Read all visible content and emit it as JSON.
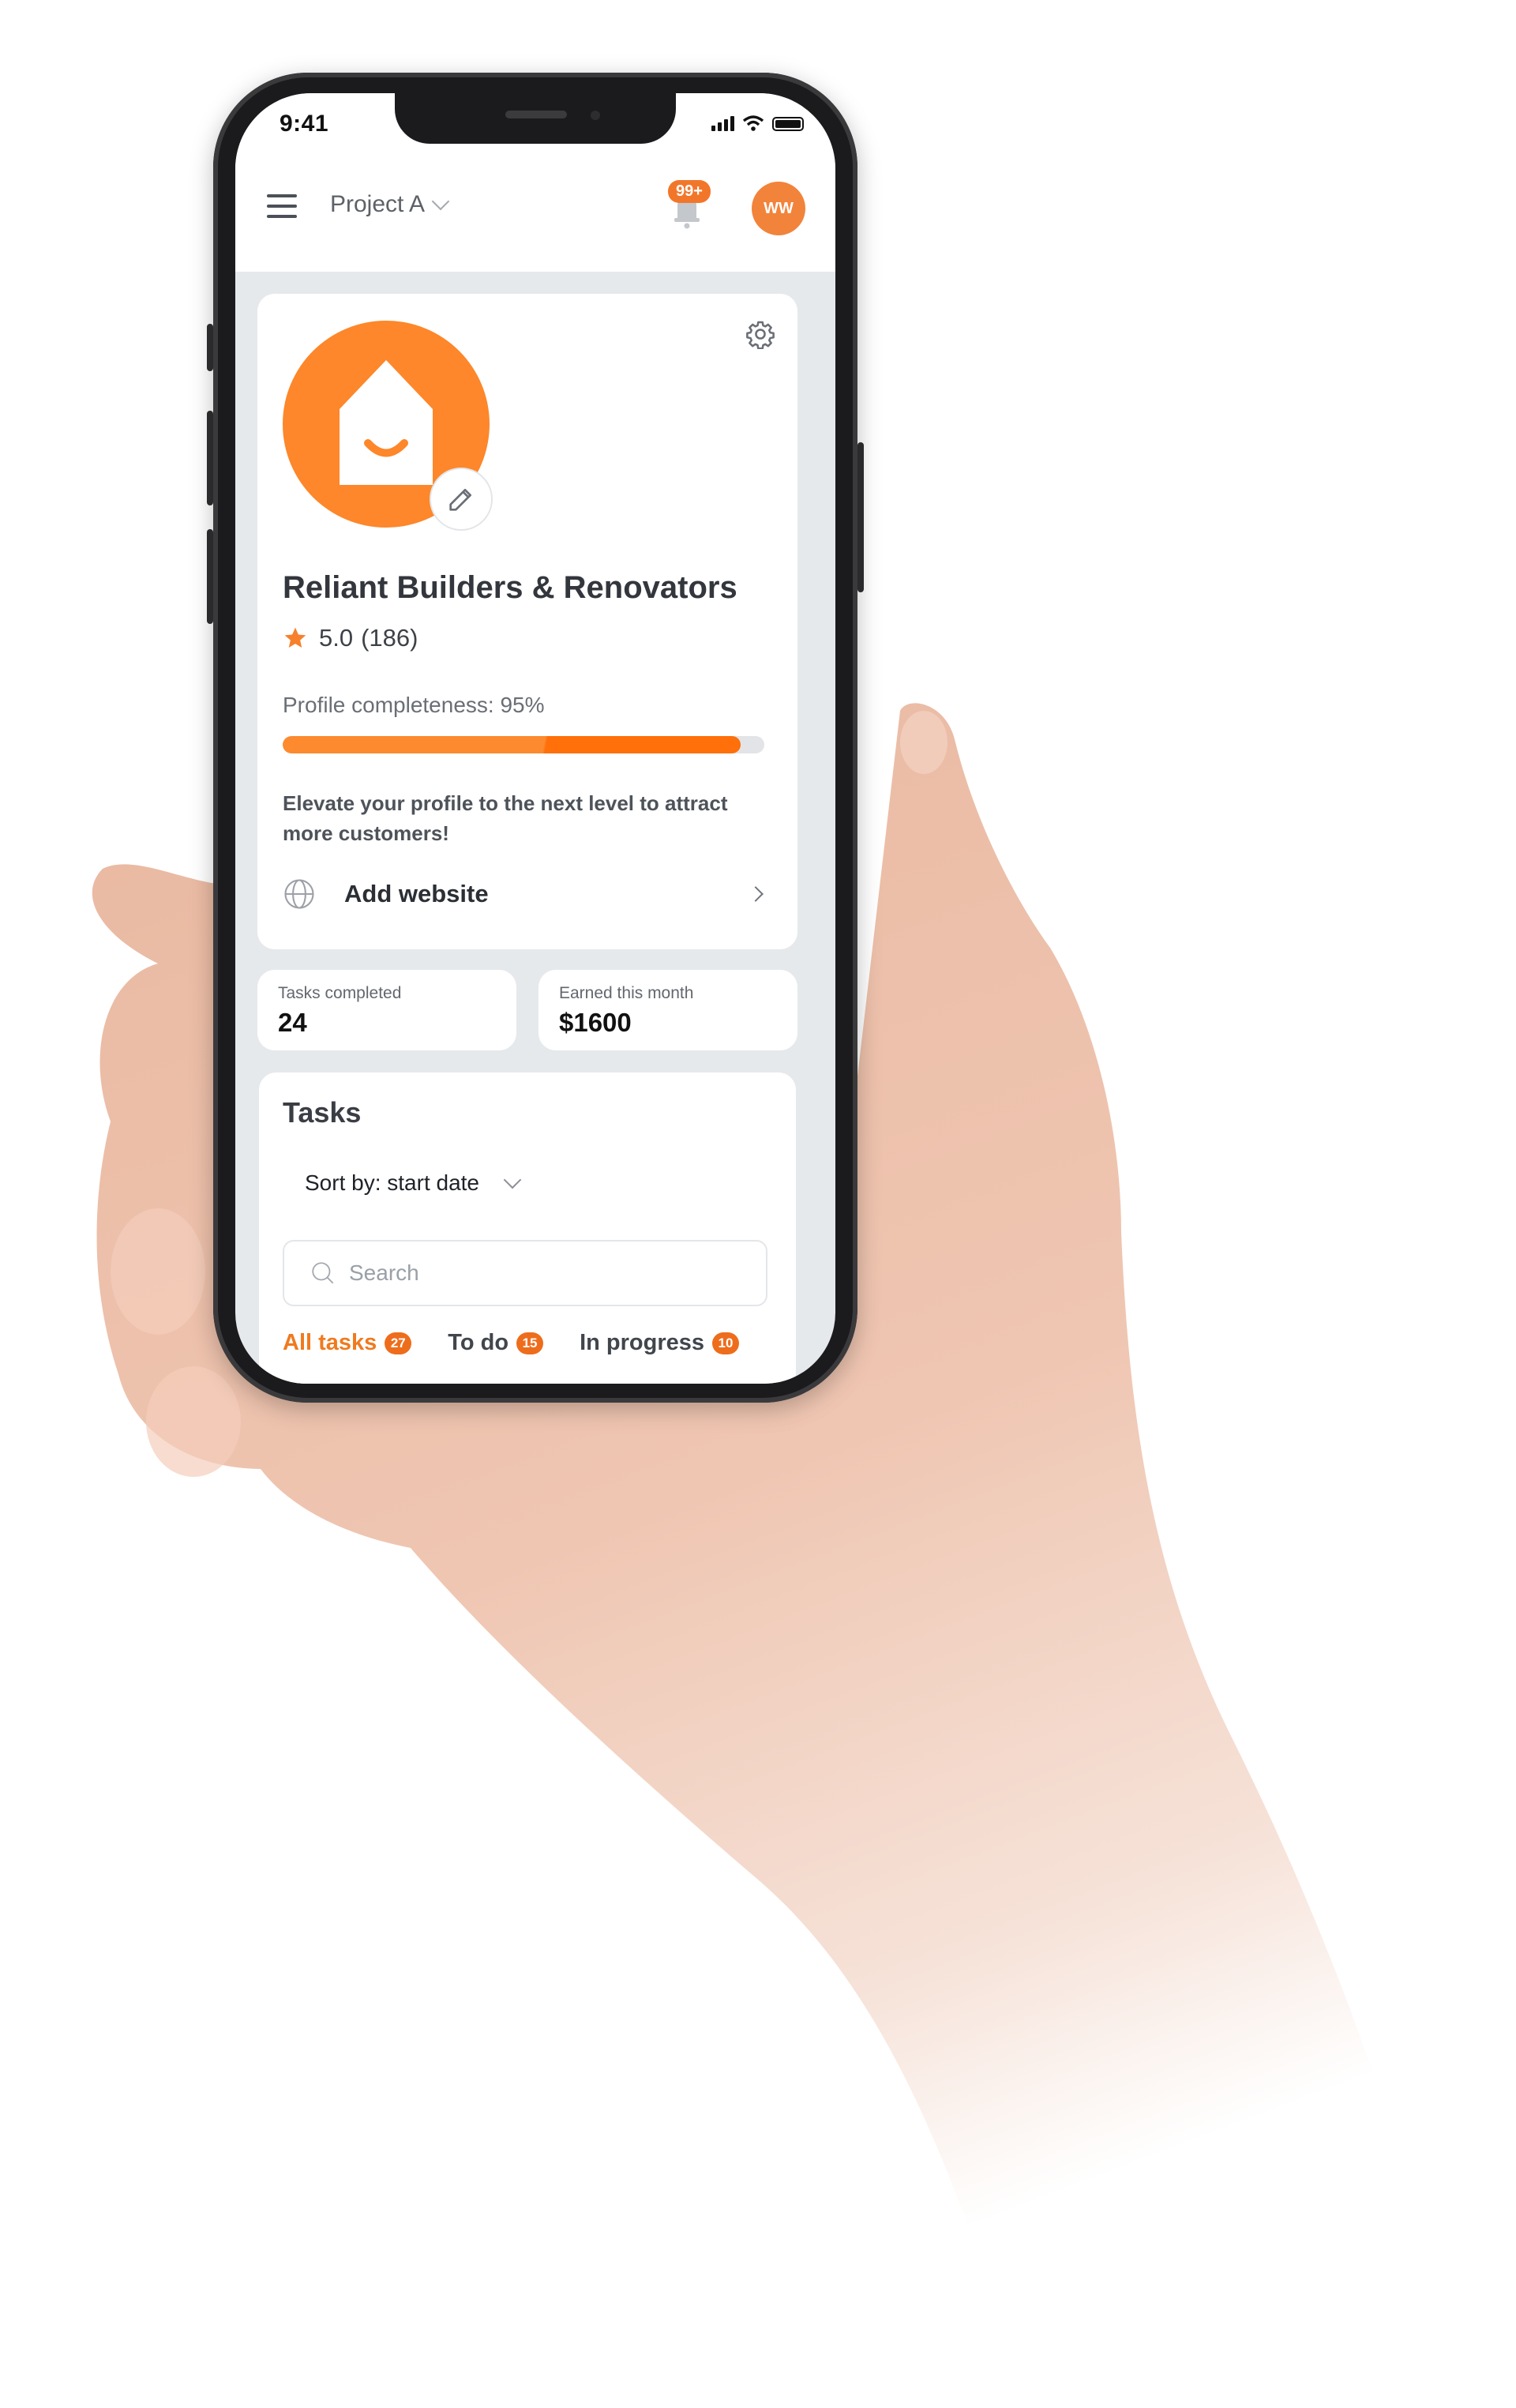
{
  "status_bar": {
    "time": "9:41"
  },
  "header": {
    "project_label": "Project A",
    "notification_badge": "99+",
    "avatar_initials": "WW"
  },
  "profile": {
    "business_name": "Reliant Builders & Renovators",
    "rating": "5.0",
    "review_count": "(186)",
    "completeness_label": "Profile completeness: 95%",
    "completeness_percent": 95,
    "elevate_text": "Elevate your profile to the next level to attract more customers!",
    "add_website_label": "Add website"
  },
  "stats": [
    {
      "label": "Tasks completed",
      "value": "24"
    },
    {
      "label": "Earned this month",
      "value": "$1600"
    }
  ],
  "tasks": {
    "title": "Tasks",
    "sort_label": "Sort by: start date",
    "search_placeholder": "Search",
    "search_value": "",
    "tabs": [
      {
        "label": "All tasks",
        "count": "27",
        "active": true
      },
      {
        "label": "To do",
        "count": "15",
        "active": false
      },
      {
        "label": "In progress",
        "count": "10",
        "active": false
      }
    ]
  },
  "colors": {
    "accent": "#fd872a",
    "accent_dark": "#ee6d1c",
    "background": "#e6e9ec"
  }
}
